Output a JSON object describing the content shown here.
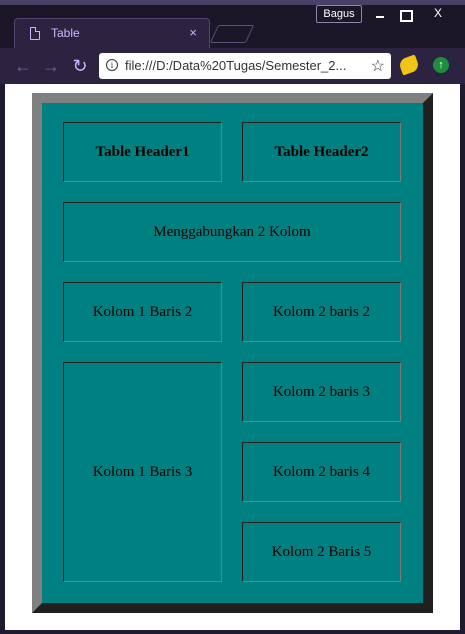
{
  "browser": {
    "tab_title": "Table",
    "tab_close": "×",
    "profile_label": "Bagus",
    "window_buttons": {
      "close": "X"
    },
    "address": "file:///D:/Data%20Tugas/Semester_2...",
    "info_glyph": "i",
    "star_glyph": "☆",
    "nav": {
      "back": "←",
      "forward": "→",
      "reload": "↻"
    },
    "ext2_glyph": "↑"
  },
  "page": {
    "table": {
      "header1": "Table Header1",
      "header2": "Table Header2",
      "merged_row": "Menggabungkan 2 Kolom",
      "row2_col1": "Kolom 1 Baris 2",
      "row2_col2": "Kolom 2 baris 2",
      "col1_span": "Kolom 1 Baris 3",
      "row3_col2": "Kolom 2 baris 3",
      "row4_col2": "Kolom 2 baris 4",
      "row5_col2": "Kolom 2 Baris 5"
    }
  },
  "colors": {
    "table_bg": "#008080",
    "page_bg": "#ffffff",
    "browser_frame": "#2b2340",
    "accent": "#c9b6ff"
  }
}
